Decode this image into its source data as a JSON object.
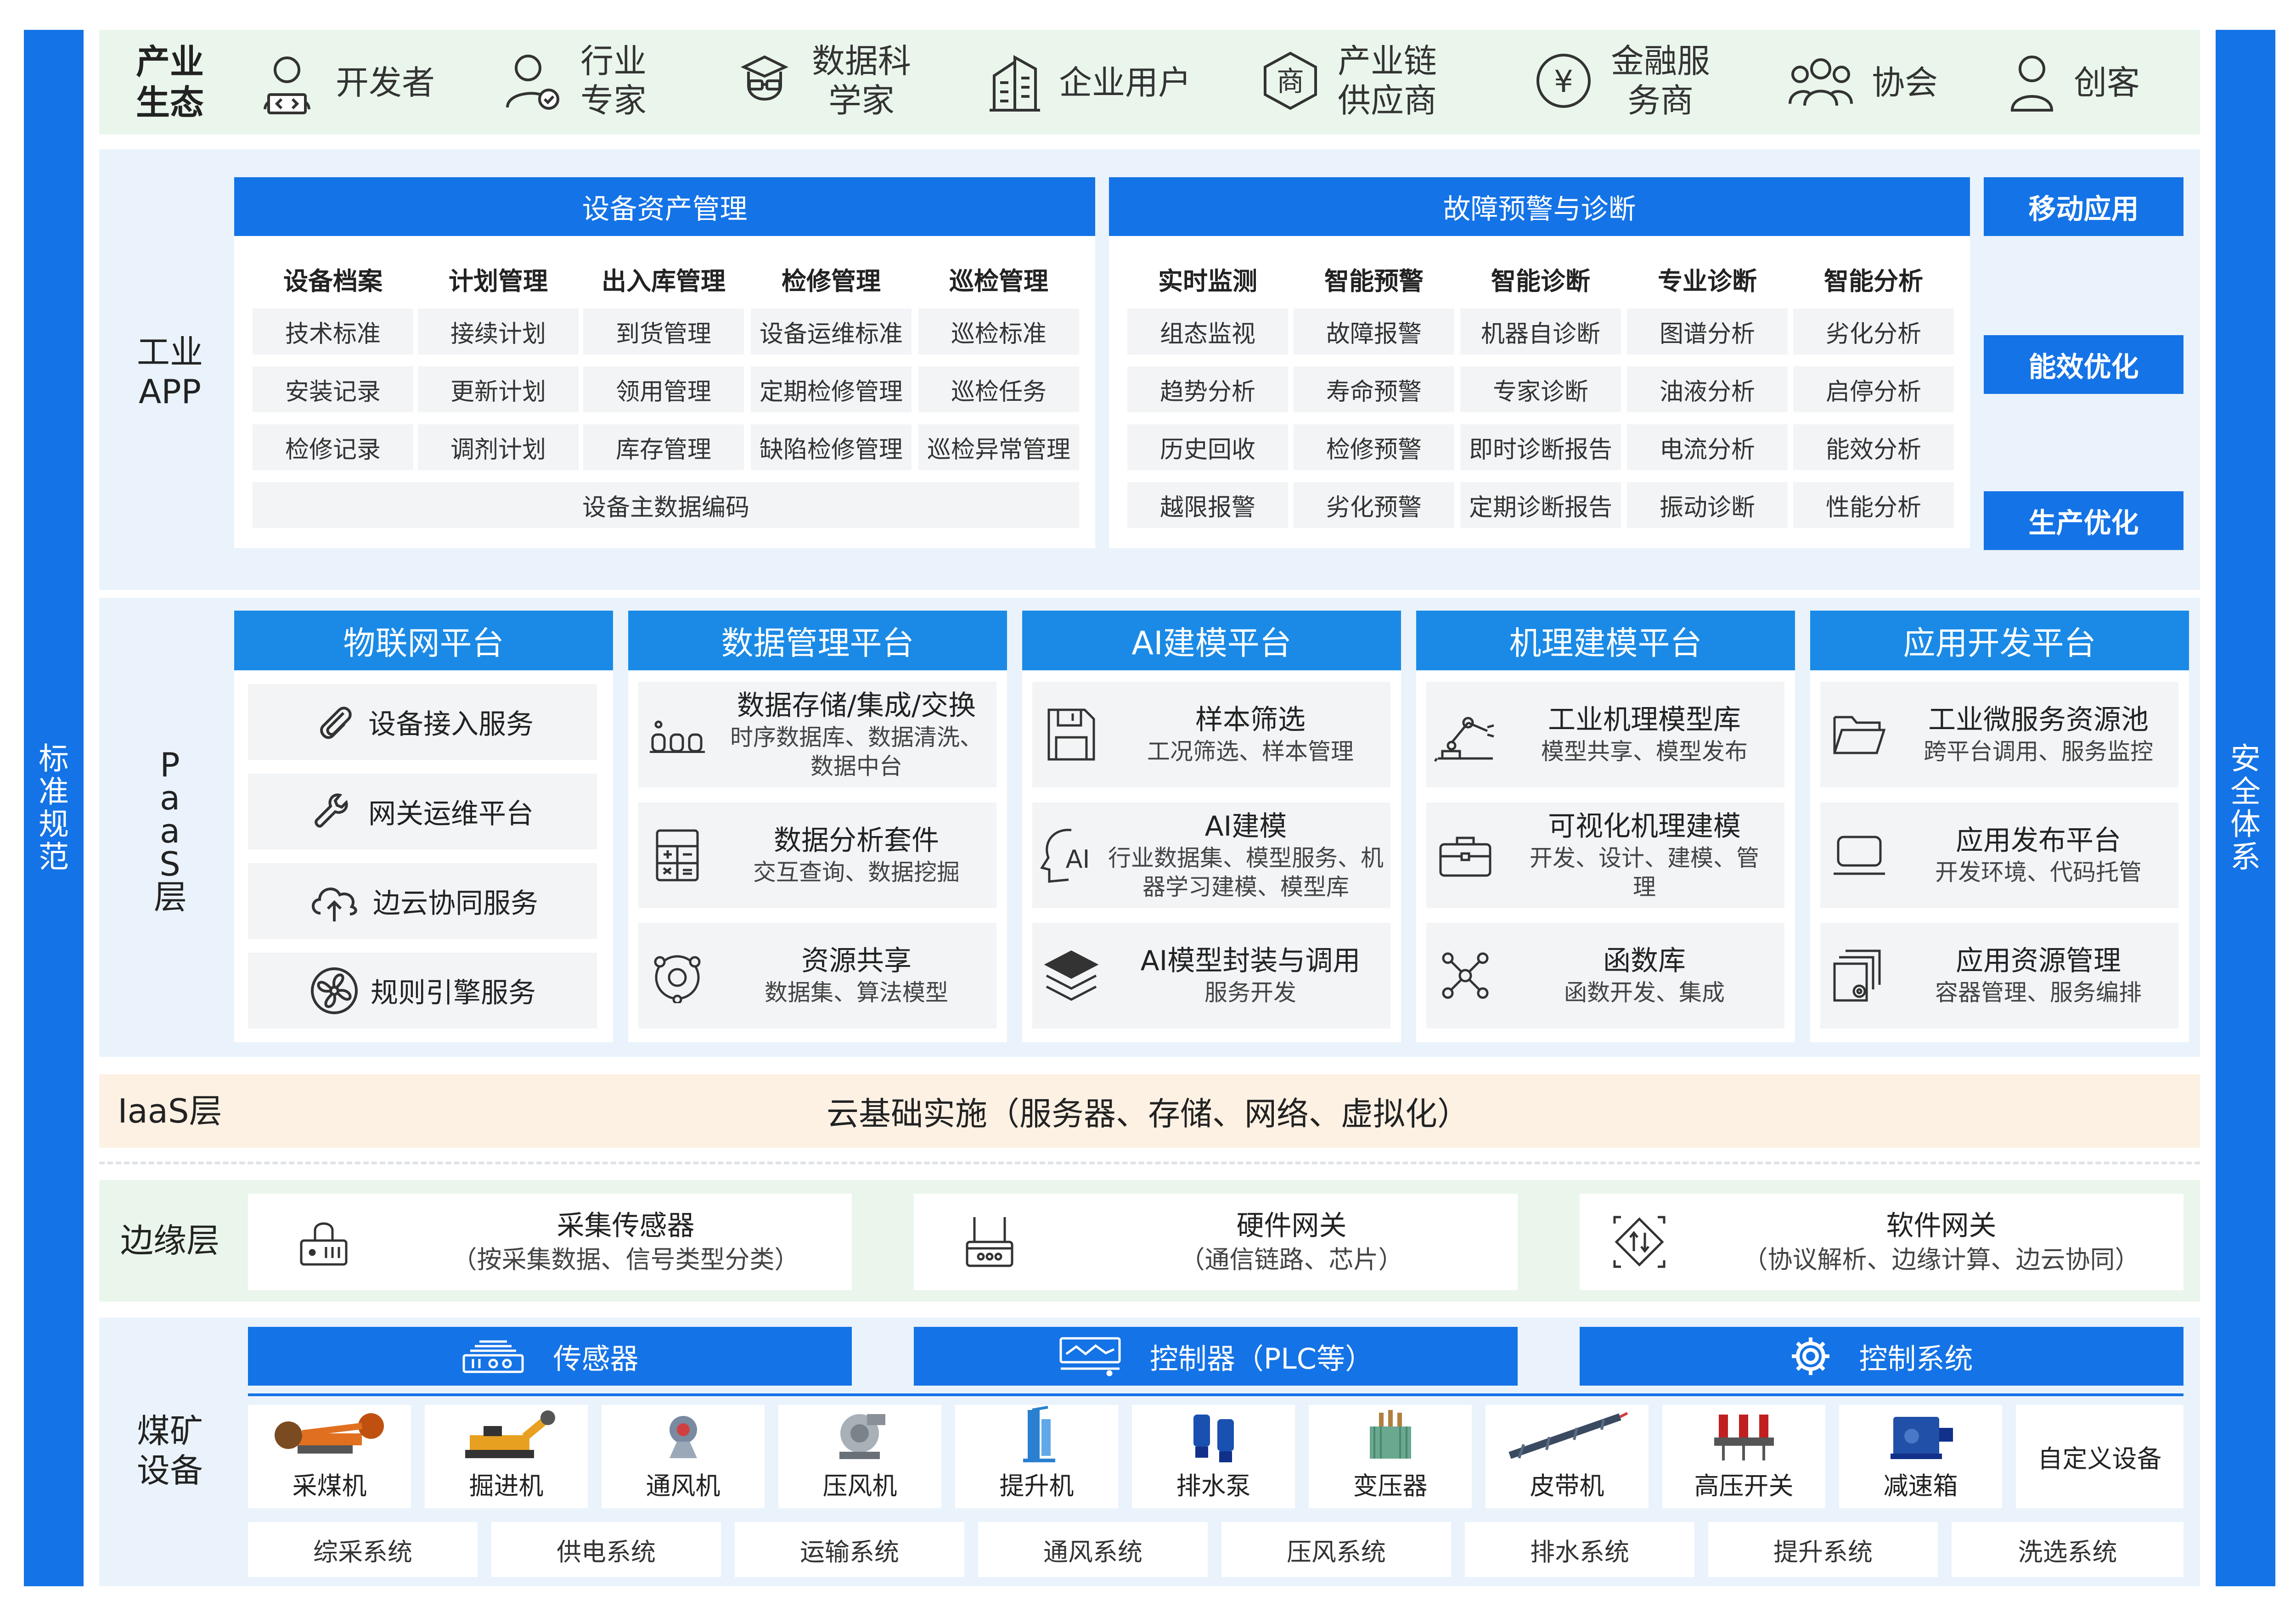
{
  "side": {
    "left": "标准规范",
    "right": "安全体系"
  },
  "ecosystem": {
    "label": "产业生态",
    "items": [
      {
        "icon": "developer-icon",
        "label": "开发者"
      },
      {
        "icon": "expert-icon",
        "label": "行业专家"
      },
      {
        "icon": "data-scientist-icon",
        "label": "数据科学家"
      },
      {
        "icon": "enterprise-icon",
        "label": "企业用户"
      },
      {
        "icon": "merchant-icon",
        "icon_text": "商",
        "label": "产业链供应商"
      },
      {
        "icon": "yuan-icon",
        "icon_text": "¥",
        "label": "金融服务商"
      },
      {
        "icon": "association-icon",
        "label": "协会"
      },
      {
        "icon": "maker-icon",
        "label": "创客"
      }
    ]
  },
  "app": {
    "label": "工业APP",
    "asset": {
      "title": "设备资产管理",
      "columns": [
        {
          "head": "设备档案",
          "cells": [
            "技术标准",
            "安装记录",
            "检修记录"
          ]
        },
        {
          "head": "计划管理",
          "cells": [
            "接续计划",
            "更新计划",
            "调剂计划"
          ]
        },
        {
          "head": "出入库管理",
          "cells": [
            "到货管理",
            "领用管理",
            "库存管理"
          ]
        },
        {
          "head": "检修管理",
          "cells": [
            "设备运维标准",
            "定期检修管理",
            "缺陷检修管理"
          ]
        },
        {
          "head": "巡检管理",
          "cells": [
            "巡检标准",
            "巡检任务",
            "巡检异常管理"
          ]
        }
      ],
      "footer": "设备主数据编码"
    },
    "fault": {
      "title": "故障预警与诊断",
      "columns": [
        {
          "head": "实时监测",
          "cells": [
            "组态监视",
            "趋势分析",
            "历史回收",
            "越限报警"
          ]
        },
        {
          "head": "智能预警",
          "cells": [
            "故障报警",
            "寿命预警",
            "检修预警",
            "劣化预警"
          ]
        },
        {
          "head": "智能诊断",
          "cells": [
            "机器自诊断",
            "专家诊断",
            "即时诊断报告",
            "定期诊断报告"
          ]
        },
        {
          "head": "专业诊断",
          "cells": [
            "图谱分析",
            "油液分析",
            "电流分析",
            "振动诊断"
          ]
        },
        {
          "head": "智能分析",
          "cells": [
            "劣化分析",
            "启停分析",
            "能效分析",
            "性能分析"
          ]
        }
      ]
    },
    "right_buttons": [
      "移动应用",
      "能效优化",
      "生产优化"
    ]
  },
  "paas": {
    "label": "PaaS层",
    "iot": {
      "title": "物联网平台",
      "items": [
        {
          "icon": "paperclip-icon",
          "label": "设备接入服务"
        },
        {
          "icon": "wrench-icon",
          "label": "网关运维平台"
        },
        {
          "icon": "cloud-upload-icon",
          "label": "边云协同服务"
        },
        {
          "icon": "fan-icon",
          "label": "规则引擎服务"
        }
      ]
    },
    "platforms": [
      {
        "title": "数据管理平台",
        "items": [
          {
            "icon": "storage-icon",
            "title": "数据存储/集成/交换",
            "desc": "时序数据库、数据清洗、数据中台"
          },
          {
            "icon": "calculator-icon",
            "title": "数据分析套件",
            "desc": "交互查询、数据挖掘"
          },
          {
            "icon": "share-icon",
            "title": "资源共享",
            "desc": "数据集、算法模型"
          }
        ]
      },
      {
        "title": "AI建模平台",
        "items": [
          {
            "icon": "floppy-icon",
            "title": "样本筛选",
            "desc": "工况筛选、样本管理"
          },
          {
            "icon": "ai-head-icon",
            "icon_text": "AI",
            "title": "AI建模",
            "desc": "行业数据集、模型服务、机器学习建模、模型库"
          },
          {
            "icon": "layers-icon",
            "title": "AI模型封装与调用",
            "desc": "服务开发"
          }
        ]
      },
      {
        "title": "机理建模平台",
        "items": [
          {
            "icon": "robot-arm-icon",
            "title": "工业机理模型库",
            "desc": "模型共享、模型发布"
          },
          {
            "icon": "briefcase-icon",
            "title": "可视化机理建模",
            "desc": "开发、设计、建模、管理"
          },
          {
            "icon": "network-icon",
            "title": "函数库",
            "desc": "函数开发、集成"
          }
        ]
      },
      {
        "title": "应用开发平台",
        "items": [
          {
            "icon": "folder-icon",
            "title": "工业微服务资源池",
            "desc": "跨平台调用、服务监控"
          },
          {
            "icon": "laptop-icon",
            "title": "应用发布平台",
            "desc": "开发环境、代码托管"
          },
          {
            "icon": "settings-doc-icon",
            "title": "应用资源管理",
            "desc": "容器管理、服务编排"
          }
        ]
      }
    ]
  },
  "iaas": {
    "label": "IaaS层",
    "text": "云基础实施（服务器、存储、网络、虚拟化）"
  },
  "edge": {
    "label": "边缘层",
    "items": [
      {
        "icon": "sensor-box-icon",
        "title": "采集传感器",
        "desc": "（按采集数据、信号类型分类）"
      },
      {
        "icon": "gateway-icon",
        "title": "硬件网关",
        "desc": "（通信链路、芯片）"
      },
      {
        "icon": "software-gateway-icon",
        "title": "软件网关",
        "desc": "（协议解析、边缘计算、边云协同）"
      }
    ]
  },
  "coal": {
    "label": "煤矿设备",
    "headers": [
      {
        "icon": "sensor-icon",
        "label": "传感器"
      },
      {
        "icon": "controller-icon",
        "label": "控制器（PLC等）"
      },
      {
        "icon": "gear-icon",
        "label": "控制系统"
      }
    ],
    "equipment": [
      {
        "icon": "shearer-icon",
        "label": "采煤机"
      },
      {
        "icon": "roadheader-icon",
        "label": "掘进机"
      },
      {
        "icon": "ventilator-icon",
        "label": "通风机"
      },
      {
        "icon": "compressor-icon",
        "label": "压风机"
      },
      {
        "icon": "hoist-icon",
        "label": "提升机"
      },
      {
        "icon": "pump-icon",
        "label": "排水泵"
      },
      {
        "icon": "transformer-icon",
        "label": "变压器"
      },
      {
        "icon": "conveyor-icon",
        "label": "皮带机"
      },
      {
        "icon": "switch-icon",
        "label": "高压开关"
      },
      {
        "icon": "reducer-icon",
        "label": "减速箱"
      },
      {
        "icon": "",
        "label": "自定义设备"
      }
    ],
    "systems": [
      "综采系统",
      "供电系统",
      "运输系统",
      "通风系统",
      "压风系统",
      "排水系统",
      "提升系统",
      "洗选系统"
    ]
  },
  "colors": {
    "primary": "#1473e6",
    "header_light": "#1a8ae6",
    "band_blue": "#eaf3fb",
    "band_green": "#eaf6ec",
    "band_orange": "#fdf1e4",
    "cell": "#f2f4f6"
  }
}
